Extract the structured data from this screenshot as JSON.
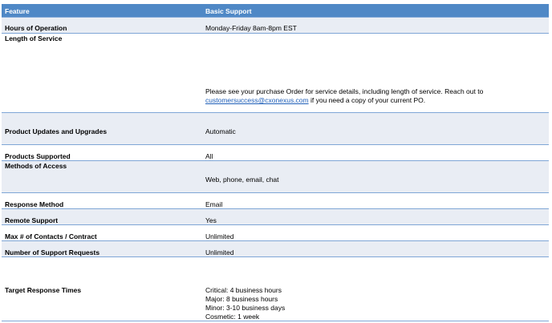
{
  "header": {
    "feature": "Feature",
    "basic": "Basic Support"
  },
  "rows": [
    {
      "feature": "Hours of Operation",
      "value": "Monday-Friday 8am-8pm EST"
    },
    {
      "feature": "Length of Service",
      "value_pre": "Please see your purchase Order for service details, including length of service. Reach out to",
      "link": "customersuccess@cxonexus.com",
      "value_post": " if you need a copy of your current PO."
    },
    {
      "feature": "Product Updates and Upgrades",
      "value": "Automatic"
    },
    {
      "feature": "Products Supported",
      "value": "All"
    },
    {
      "feature": "Methods of Access",
      "value": "Web, phone, email, chat"
    },
    {
      "feature": "Response Method",
      "value": "Email"
    },
    {
      "feature": "Remote Support",
      "value": "Yes"
    },
    {
      "feature": "Max # of Contacts / Contract",
      "value": "Unlimited"
    },
    {
      "feature": "Number of Support Requests",
      "value": "Unlimited"
    },
    {
      "feature": "Target Response Times",
      "lines": [
        "Critical: 4 business hours",
        "Major: 8 business hours",
        "Minor: 3-10 business days",
        "Cosmetic: 1 week"
      ]
    }
  ]
}
